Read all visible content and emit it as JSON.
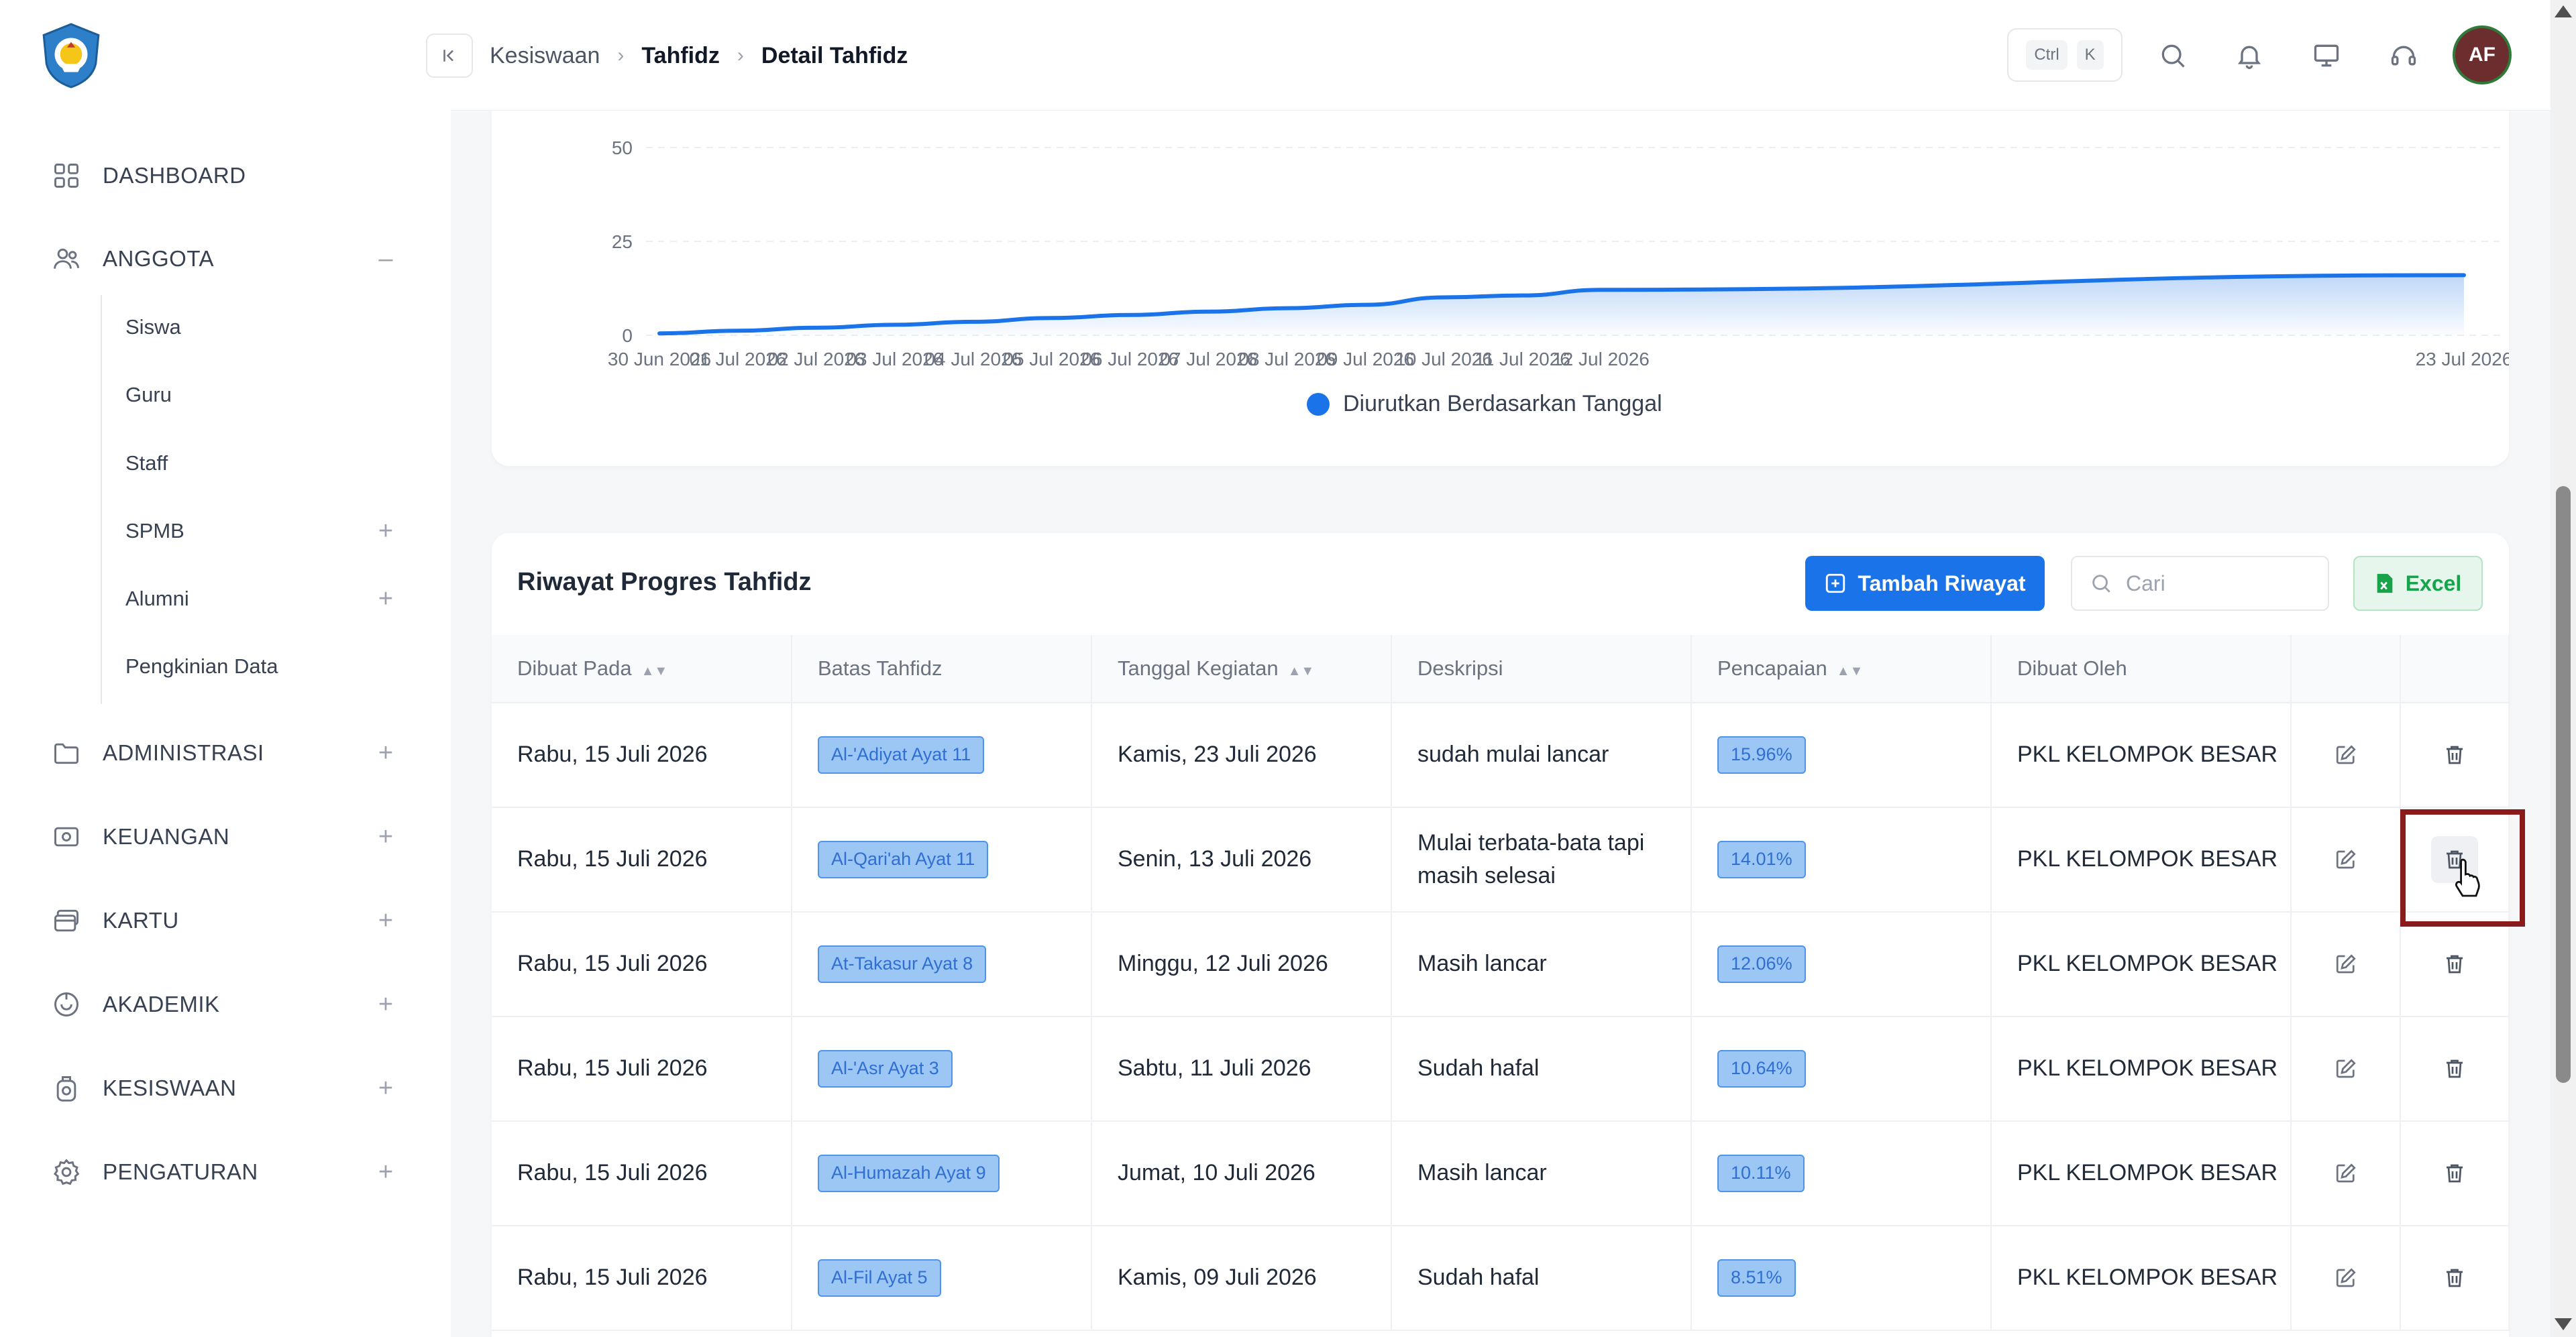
{
  "sidebar": {
    "items": [
      {
        "label": "DASHBOARD",
        "icon": "grid-icon"
      },
      {
        "label": "ANGGOTA",
        "icon": "users-icon",
        "toggle": "–"
      },
      {
        "label": "ADMINISTRASI",
        "icon": "folder-icon",
        "toggle": "+"
      },
      {
        "label": "KEUANGAN",
        "icon": "money-icon",
        "toggle": "+"
      },
      {
        "label": "KARTU",
        "icon": "card-icon",
        "toggle": "+"
      },
      {
        "label": "AKADEMIK",
        "icon": "academic-icon",
        "toggle": "+"
      },
      {
        "label": "KESISWAAN",
        "icon": "student-icon",
        "toggle": "+"
      },
      {
        "label": "PENGATURAN",
        "icon": "gear-icon",
        "toggle": "+"
      }
    ],
    "anggota_sub": [
      {
        "label": "Siswa"
      },
      {
        "label": "Guru"
      },
      {
        "label": "Staff"
      },
      {
        "label": "SPMB",
        "toggle": "+"
      },
      {
        "label": "Alumni",
        "toggle": "+"
      },
      {
        "label": "Pengkinian Data"
      }
    ]
  },
  "header": {
    "breadcrumb": [
      "Kesiswaan",
      "Tahfidz",
      "Detail Tahfidz"
    ],
    "kbd": [
      "Ctrl",
      "K"
    ],
    "avatar": "AF"
  },
  "chart_data": {
    "type": "area",
    "x": [
      "30 Jun 2026",
      "01 Jul 2026",
      "02 Jul 2026",
      "03 Jul 2026",
      "04 Jul 2026",
      "05 Jul 2026",
      "06 Jul 2026",
      "07 Jul 2026",
      "08 Jul 2026",
      "09 Jul 2026",
      "10 Jul 2026",
      "11 Jul 2026",
      "12 Jul 2026",
      "23 Jul 2026"
    ],
    "series": [
      {
        "name": "Diurutkan Berdasarkan Tanggal",
        "values": [
          0.5,
          1.2,
          2.0,
          2.8,
          3.6,
          4.6,
          5.4,
          6.3,
          7.2,
          8.1,
          10.1,
          10.6,
          12.1,
          16.0
        ]
      }
    ],
    "yticks": [
      "0",
      "25",
      "50"
    ],
    "ylim": [
      0,
      50
    ],
    "grid": true,
    "legend": "bottom",
    "color": "#1a73e8"
  },
  "table": {
    "title": "Riwayat Progres Tahfidz",
    "add_label": "Tambah Riwayat",
    "search_placeholder": "Cari",
    "excel_label": "Excel",
    "columns": [
      "Dibuat Pada",
      "Batas Tahfidz",
      "Tanggal Kegiatan",
      "Deskripsi",
      "Pencapaian",
      "Dibuat Oleh"
    ],
    "rows": [
      {
        "created": "Rabu, 15 Juli 2026",
        "limit": "Al-'Adiyat Ayat 11",
        "date": "Kamis, 23 Juli 2026",
        "desc": "sudah mulai lancar",
        "achievement": "15.96%",
        "by": "PKL KELOMPOK BESAR"
      },
      {
        "created": "Rabu, 15 Juli 2026",
        "limit": "Al-Qari'ah Ayat 11",
        "date": "Senin, 13 Juli 2026",
        "desc": "Mulai terbata-bata tapi masih selesai",
        "achievement": "14.01%",
        "by": "PKL KELOMPOK BESAR"
      },
      {
        "created": "Rabu, 15 Juli 2026",
        "limit": "At-Takasur Ayat 8",
        "date": "Minggu, 12 Juli 2026",
        "desc": "Masih lancar",
        "achievement": "12.06%",
        "by": "PKL KELOMPOK BESAR"
      },
      {
        "created": "Rabu, 15 Juli 2026",
        "limit": "Al-'Asr Ayat 3",
        "date": "Sabtu, 11 Juli 2026",
        "desc": "Sudah hafal",
        "achievement": "10.64%",
        "by": "PKL KELOMPOK BESAR"
      },
      {
        "created": "Rabu, 15 Juli 2026",
        "limit": "Al-Humazah Ayat 9",
        "date": "Jumat, 10 Juli 2026",
        "desc": "Masih lancar",
        "achievement": "10.11%",
        "by": "PKL KELOMPOK BESAR"
      },
      {
        "created": "Rabu, 15 Juli 2026",
        "limit": "Al-Fil Ayat 5",
        "date": "Kamis, 09 Juli 2026",
        "desc": "Sudah hafal",
        "achievement": "8.51%",
        "by": "PKL KELOMPOK BESAR"
      }
    ]
  }
}
